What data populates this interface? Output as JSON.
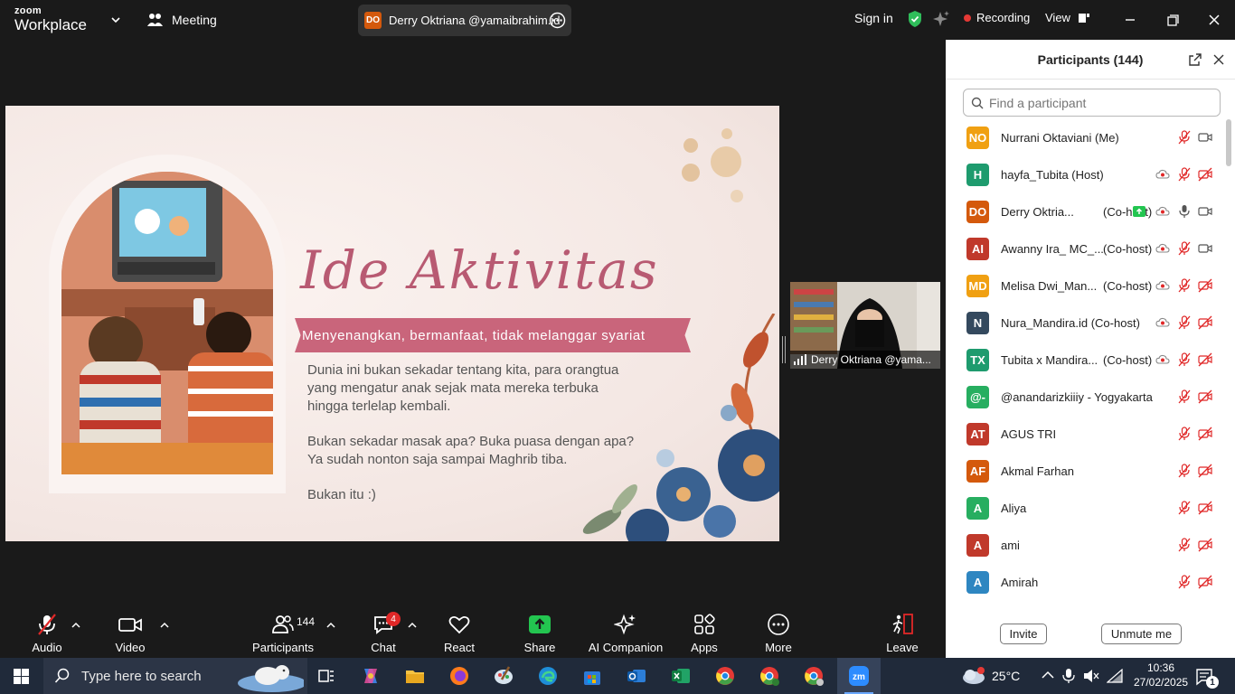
{
  "titlebar": {
    "logo_line1": "zoom",
    "logo_line2": "Workplace",
    "meeting_label": "Meeting",
    "speaker_initials": "DO",
    "speaker_name": "Derry Oktriana @yamaibrahim.id",
    "signin": "Sign in",
    "recording": "Recording",
    "view": "View"
  },
  "slide": {
    "title": "Ide Aktivitas",
    "banner": "Menyenangkan, bermanfaat, tidak melanggar syariat",
    "para1": [
      "Dunia ini bukan sekadar tentang kita, para orangtua",
      "yang mengatur anak sejak mata mereka terbuka",
      "hingga terlelap kembali."
    ],
    "para2": [
      "Bukan sekadar masak apa? Buka puasa dengan apa?",
      "Ya sudah nonton saja sampai Maghrib tiba."
    ],
    "para3": "Bukan itu :)"
  },
  "video_thumb": {
    "name": "Derry Oktriana @yama..."
  },
  "participants": {
    "title": "Participants (144)",
    "search_placeholder": "Find a participant",
    "invite": "Invite",
    "unmute_me": "Unmute me",
    "rows": [
      {
        "initials": "NO",
        "color": "#f0a012",
        "name": "Nurrani Oktaviani (Me)",
        "role": "",
        "cloud": false,
        "mic": "muted",
        "cam": "on"
      },
      {
        "initials": "H",
        "color": "#1e9b6e",
        "name": "hayfa_Tubita (Host)",
        "role": "",
        "cloud": true,
        "mic": "muted",
        "cam": "off"
      },
      {
        "initials": "DO",
        "color": "#d4590c",
        "name": "Derry Oktria...",
        "role": "(Co-host)",
        "share": true,
        "cloud": true,
        "mic": "on",
        "cam": "on"
      },
      {
        "initials": "AI",
        "color": "#c0392b",
        "name": "Awanny Ira_ MC_...",
        "role": "(Co-host)",
        "cloud": true,
        "mic": "muted",
        "cam": "on"
      },
      {
        "initials": "MD",
        "color": "#f0a012",
        "name": "Melisa Dwi_Man...",
        "role": "(Co-host)",
        "cloud": true,
        "mic": "muted",
        "cam": "off"
      },
      {
        "initials": "N",
        "color": "#34495e",
        "name": "Nura_Mandira.id (Co-host)",
        "role": "",
        "cloud": true,
        "mic": "muted",
        "cam": "off"
      },
      {
        "initials": "TX",
        "color": "#1e9b6e",
        "name": "Tubita x Mandira...",
        "role": "(Co-host)",
        "cloud": true,
        "mic": "muted",
        "cam": "off"
      },
      {
        "initials": "@-",
        "color": "#27ae60",
        "name": "@anandarizkiiiy - Yogyakarta",
        "role": "",
        "cloud": false,
        "mic": "muted",
        "cam": "off"
      },
      {
        "initials": "AT",
        "color": "#c0392b",
        "name": "AGUS TRI",
        "role": "",
        "cloud": false,
        "mic": "muted",
        "cam": "off"
      },
      {
        "initials": "AF",
        "color": "#d4590c",
        "name": "Akmal Farhan",
        "role": "",
        "cloud": false,
        "mic": "muted",
        "cam": "off"
      },
      {
        "initials": "A",
        "color": "#27ae60",
        "name": "Aliya",
        "role": "",
        "cloud": false,
        "mic": "muted",
        "cam": "off"
      },
      {
        "initials": "A",
        "color": "#c0392b",
        "name": "ami",
        "role": "",
        "cloud": false,
        "mic": "muted",
        "cam": "off"
      },
      {
        "initials": "A",
        "color": "#2e86c1",
        "name": "Amirah",
        "role": "",
        "cloud": false,
        "mic": "muted",
        "cam": "off"
      }
    ]
  },
  "toolbar": {
    "audio": "Audio",
    "video": "Video",
    "participants": "Participants",
    "participants_count": "144",
    "chat": "Chat",
    "chat_badge": "4",
    "react": "React",
    "share": "Share",
    "ai": "AI Companion",
    "apps": "Apps",
    "more": "More",
    "leave": "Leave"
  },
  "taskbar": {
    "search_placeholder": "Type here to search",
    "weather": "25°C",
    "time": "10:36",
    "date": "27/02/2025",
    "notif_count": "1"
  }
}
